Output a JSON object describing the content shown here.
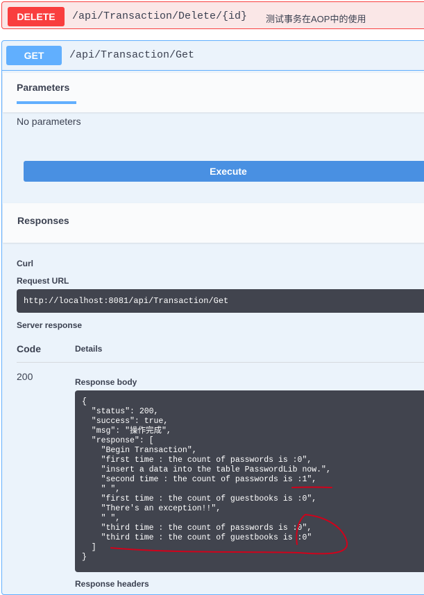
{
  "delete_op": {
    "method": "DELETE",
    "path": "/api/Transaction/Delete/{id}",
    "summary": "测试事务在AOP中的使用"
  },
  "get_op": {
    "method": "GET",
    "path": "/api/Transaction/Get",
    "parameters_tab": "Parameters",
    "no_parameters": "No parameters",
    "execute_label": "Execute",
    "responses_title": "Responses",
    "curl_label": "Curl",
    "request_url_label": "Request URL",
    "request_url": "http://localhost:8081/api/Transaction/Get",
    "server_response_label": "Server response",
    "col_code": "Code",
    "col_details": "Details",
    "status_code": "200",
    "response_body_label": "Response body",
    "response_headers_label": "Response headers",
    "response_body_lines": [
      "{",
      "  \"status\": 200,",
      "  \"success\": true,",
      "  \"msg\": \"操作完成\",",
      "  \"response\": [",
      "    \"Begin Transaction\",",
      "    \"first time : the count of passwords is :0\",",
      "    \"insert a data into the table PasswordLib now.\",",
      "    \"second time : the count of passwords is :1\",",
      "    \" \",",
      "    \"first time : the count of guestbooks is :0\",",
      "    \"There's an exception!!\",",
      "    \" \",",
      "    \"third time : the count of passwords is :0\",",
      "    \"third time : the count of guestbooks is :0\"",
      "  ]",
      "}"
    ]
  },
  "colors": {
    "delete": "#f93e3e",
    "get": "#61affe",
    "execute": "#4990e2",
    "code_bg": "#41444e",
    "annotation": "#d0021b"
  }
}
